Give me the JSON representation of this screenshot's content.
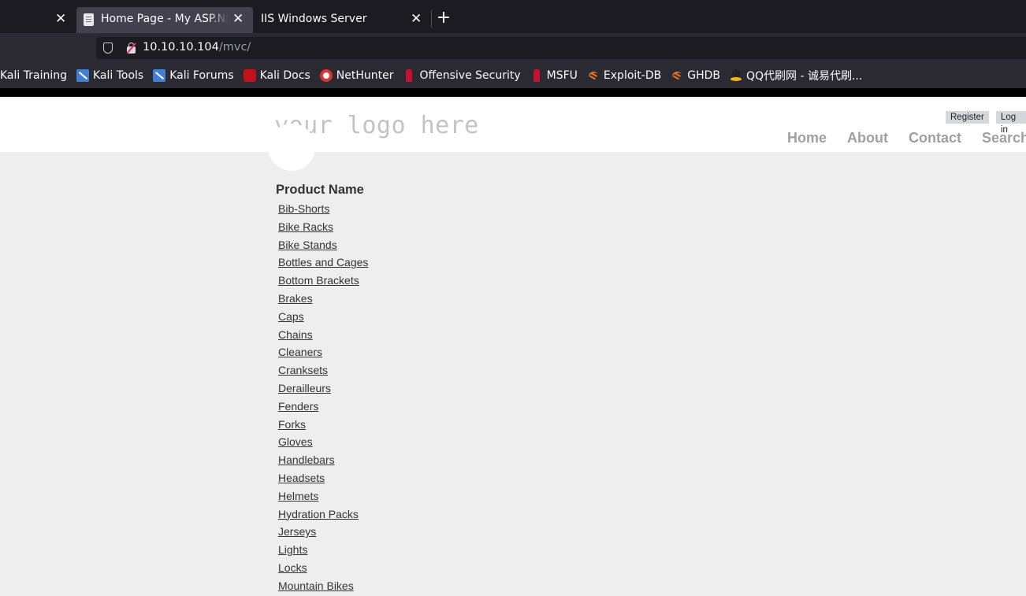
{
  "browser": {
    "tabs": [
      {
        "title": "Home Page - My ASP.NET Application",
        "active": true
      },
      {
        "title": "IIS Windows Server",
        "active": false
      }
    ],
    "close_glyph": "✕",
    "new_tab_glyph": "+",
    "url": {
      "host": "10.10.10.104",
      "path": "/mvc/"
    },
    "bookmarks": [
      {
        "label": "Kali Training",
        "icon": "none"
      },
      {
        "label": "Kali Tools",
        "icon": "kali-icon"
      },
      {
        "label": "Kali Forums",
        "icon": "kali-icon"
      },
      {
        "label": "Kali Docs",
        "icon": "kali-docs-icon"
      },
      {
        "label": "NetHunter",
        "icon": "nethunter-icon"
      },
      {
        "label": "Offensive Security",
        "icon": "offsec-icon"
      },
      {
        "label": "MSFU",
        "icon": "offsec-icon"
      },
      {
        "label": "Exploit-DB",
        "icon": "exploitdb-icon"
      },
      {
        "label": "GHDB",
        "icon": "exploitdb-icon"
      },
      {
        "label": "QQ代刷网 - 诚易代刷...",
        "icon": "qq-icon"
      }
    ]
  },
  "site": {
    "logo": "your logo here",
    "account": {
      "register": "Register",
      "login": "Log in"
    },
    "menu": [
      "Home",
      "About",
      "Contact",
      "Search"
    ]
  },
  "products": {
    "header": "Product Name",
    "items": [
      "Bib-Shorts",
      "Bike Racks",
      "Bike Stands",
      "Bottles and Cages",
      "Bottom Brackets",
      "Brakes",
      "Caps",
      "Chains",
      "Cleaners",
      "Cranksets",
      "Derailleurs",
      "Fenders",
      "Forks",
      "Gloves",
      "Handlebars",
      "Headsets",
      "Helmets",
      "Hydration Packs",
      "Jerseys",
      "Lights",
      "Locks",
      "Mountain Bikes"
    ]
  }
}
